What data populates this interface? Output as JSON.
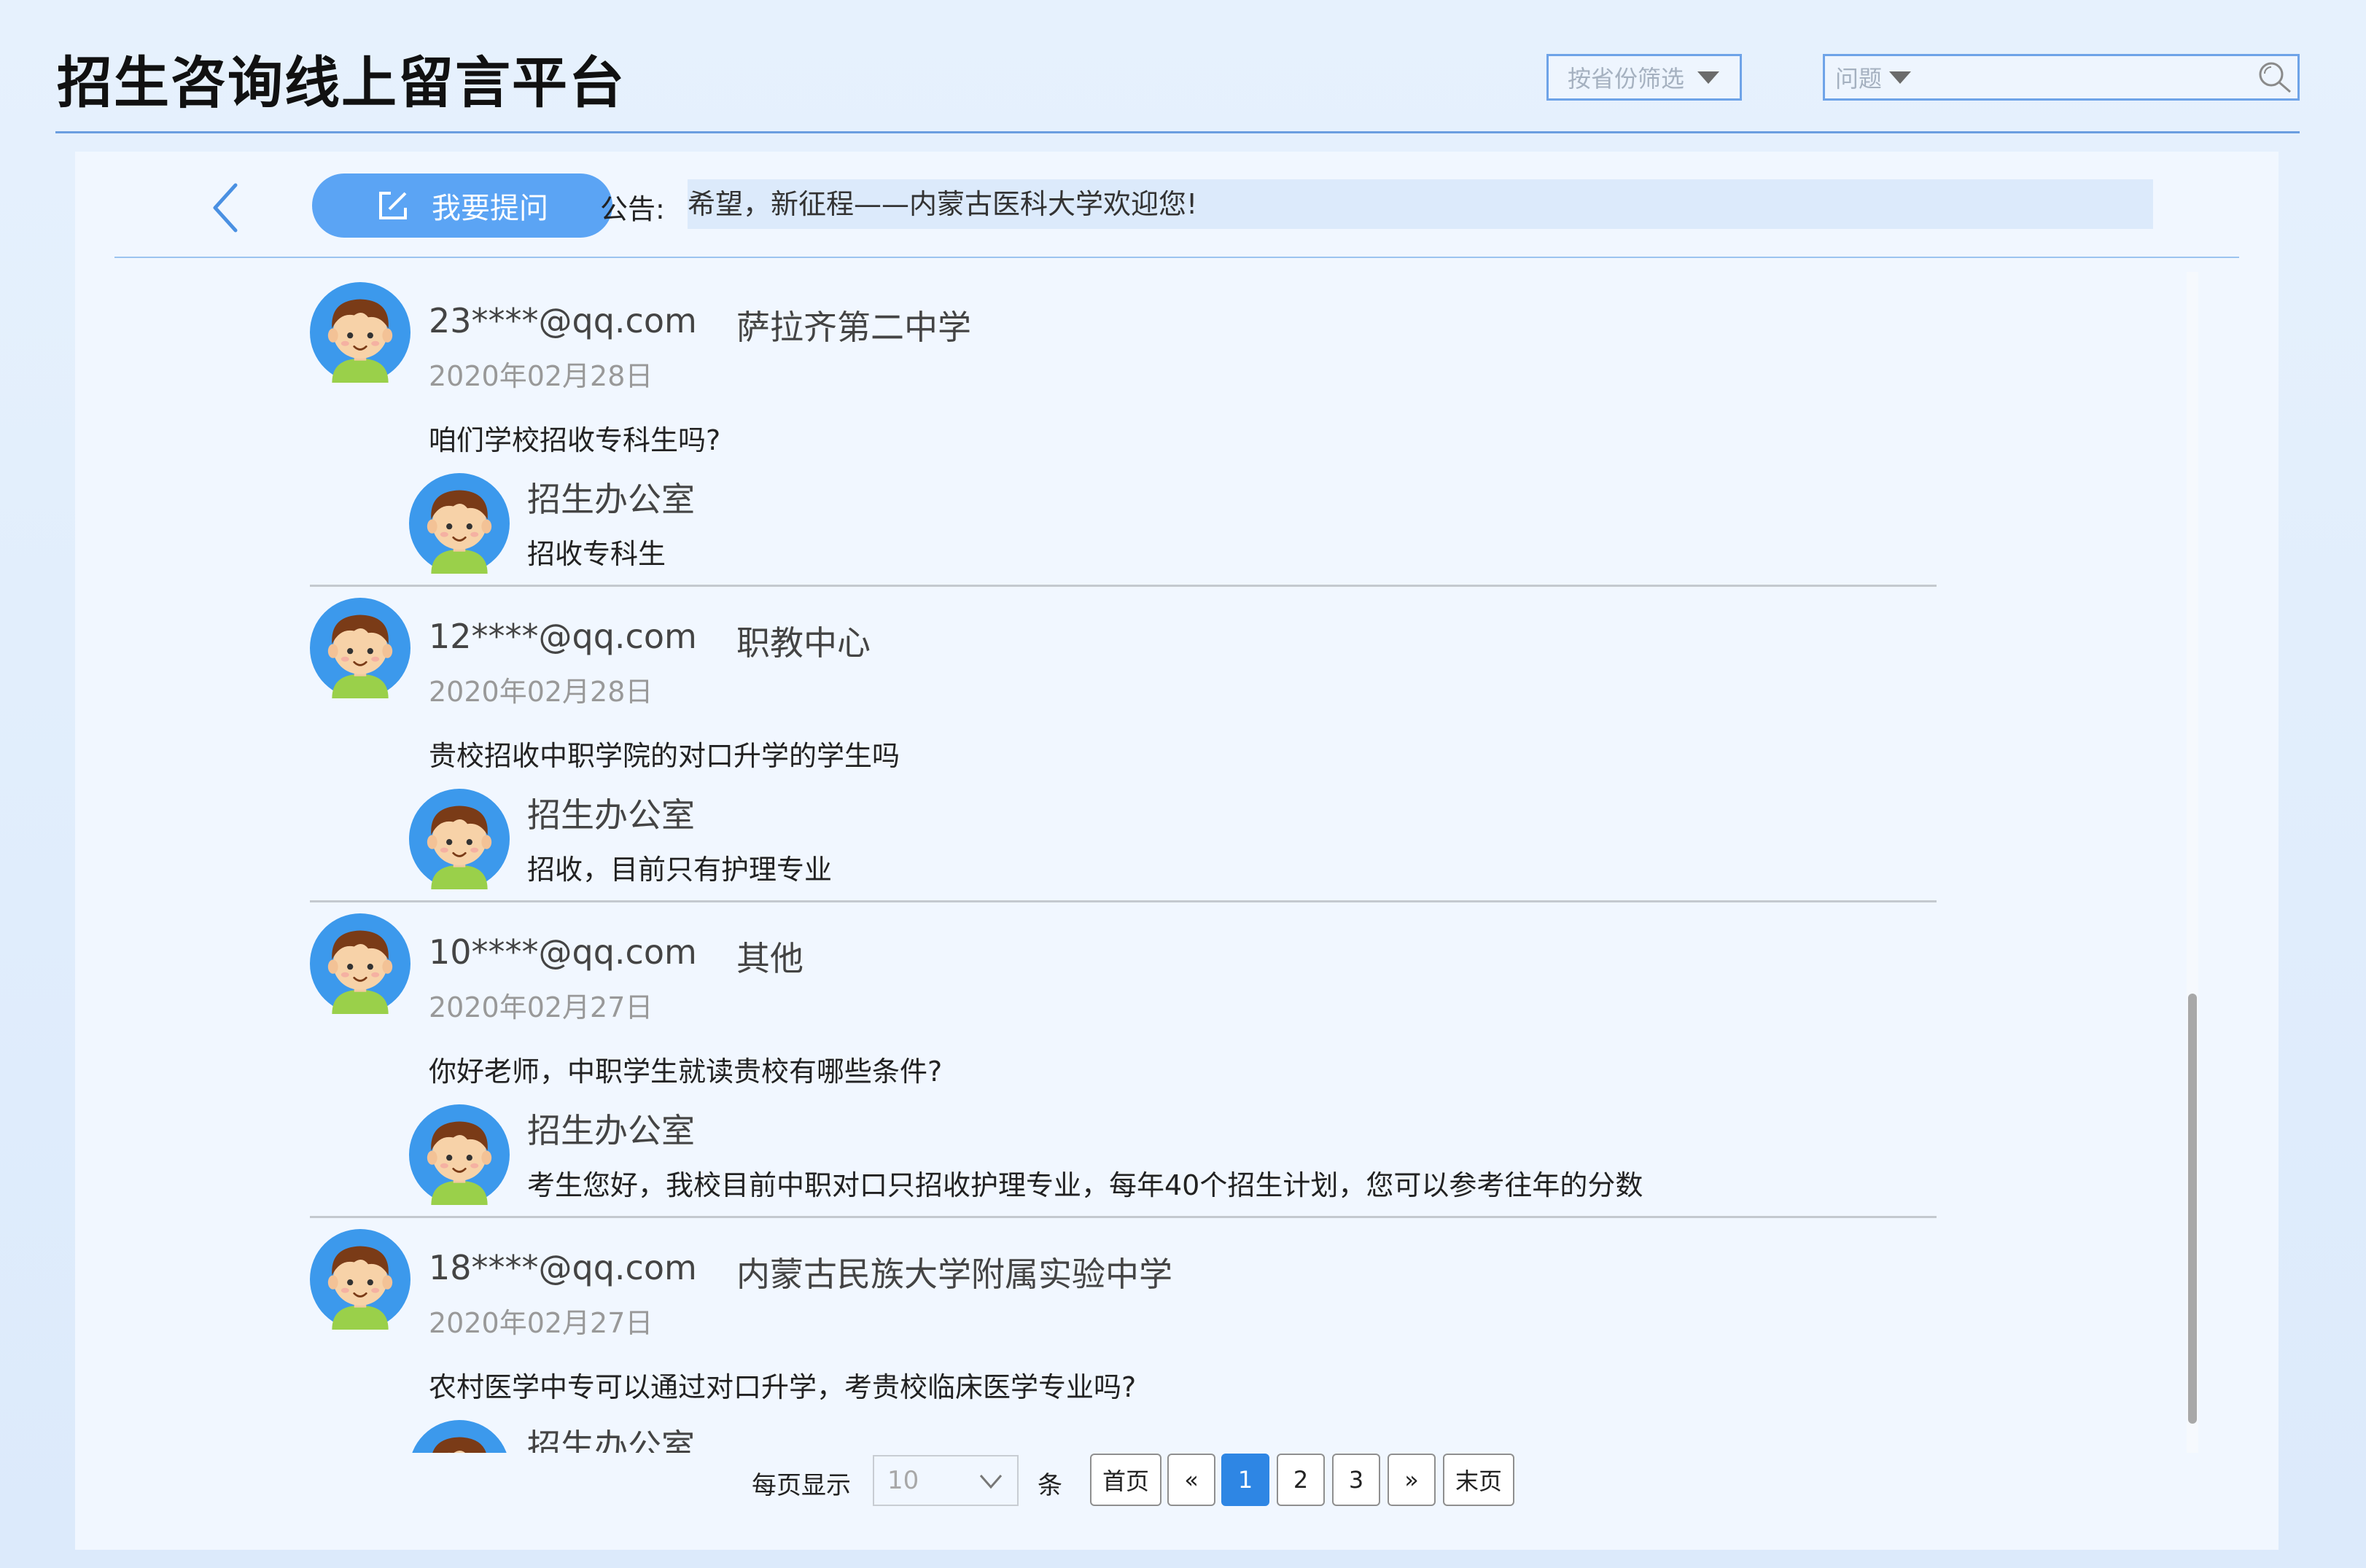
{
  "header": {
    "title": "招生咨询线上留言平台",
    "province_filter": "按省份筛选",
    "search_type": "问题",
    "search_value": ""
  },
  "toolbar": {
    "ask_button": "我要提问",
    "notice_label": "公告:",
    "notice_text": "希望，新征程——内蒙古医科大学欢迎您!"
  },
  "messages": [
    {
      "email": "23****@qq.com",
      "school": "萨拉齐第二中学",
      "date": "2020年02月28日",
      "question": "咱们学校招收专科生吗?",
      "reply_name": "招生办公室",
      "reply": "招收专科生"
    },
    {
      "email": "12****@qq.com",
      "school": "职教中心",
      "date": "2020年02月28日",
      "question": "贵校招收中职学院的对口升学的学生吗",
      "reply_name": "招生办公室",
      "reply": "招收，目前只有护理专业"
    },
    {
      "email": "10****@qq.com",
      "school": "其他",
      "date": "2020年02月27日",
      "question": "你好老师，中职学生就读贵校有哪些条件?",
      "reply_name": "招生办公室",
      "reply": "考生您好，我校目前中职对口只招收护理专业，每年40个招生计划，您可以参考往年的分数"
    },
    {
      "email": "18****@qq.com",
      "school": "内蒙古民族大学附属实验中学",
      "date": "2020年02月27日",
      "question": "农村医学中专可以通过对口升学，考贵校临床医学专业吗?",
      "reply_name": "招生办公室",
      "reply": ""
    }
  ],
  "pagination": {
    "per_page_label": "每页显示",
    "per_page_value": "10",
    "unit_label": "条",
    "first": "首页",
    "prev": "«",
    "pages": [
      "1",
      "2",
      "3"
    ],
    "current_page": "1",
    "next": "»",
    "last": "末页"
  },
  "colors": {
    "accent": "#5ba4f4",
    "active_page": "#2e86e4",
    "header_line": "#6b9ee0",
    "panel_bg": "#f1f7ff"
  },
  "icons": {
    "back": "chevron-left-icon",
    "ask": "edit-icon",
    "province_dropdown": "caret-down-icon",
    "search_type_dropdown": "caret-down-icon",
    "search": "search-icon",
    "avatar": "boy-avatar-icon",
    "page_size_dropdown": "chevron-down-icon"
  }
}
